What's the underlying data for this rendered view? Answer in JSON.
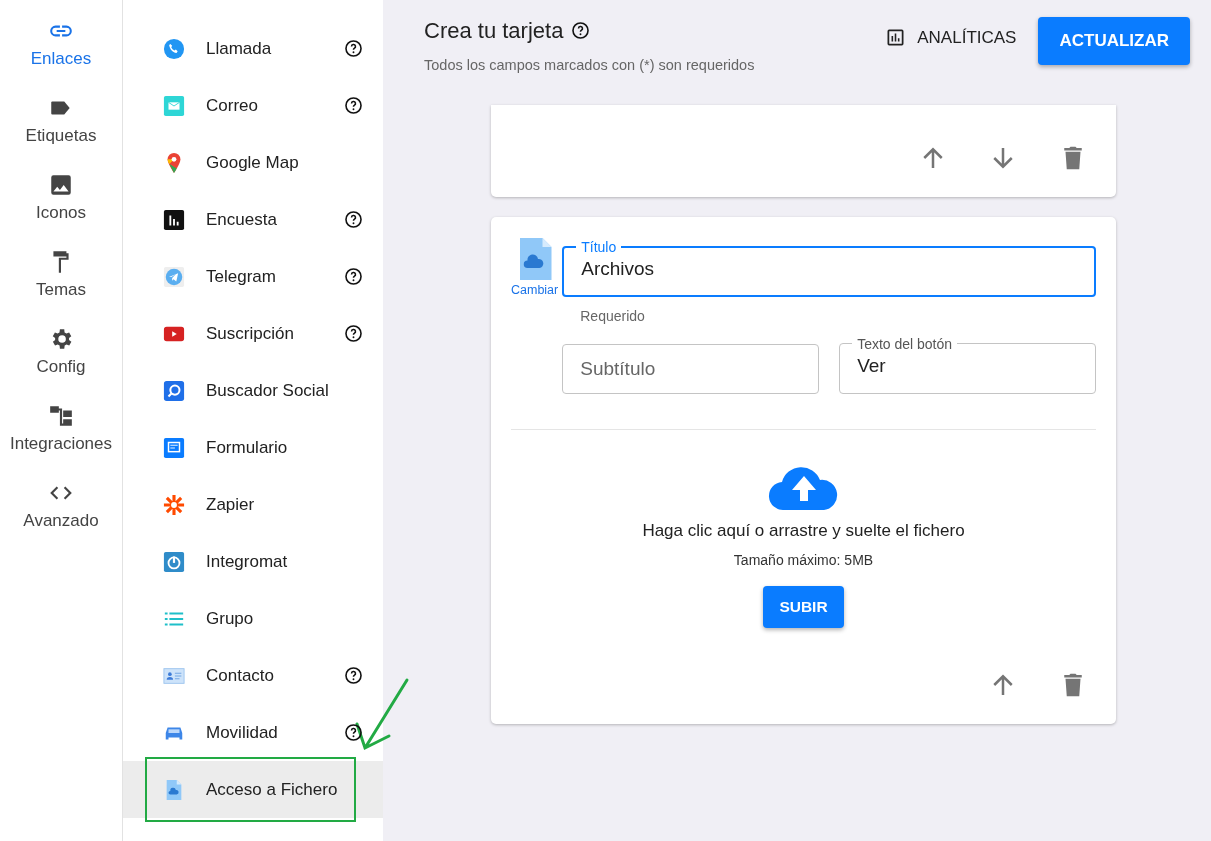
{
  "nav_rail": [
    {
      "label": "Enlaces",
      "selected": true
    },
    {
      "label": "Etiquetas",
      "selected": false
    },
    {
      "label": "Iconos",
      "selected": false
    },
    {
      "label": "Temas",
      "selected": false
    },
    {
      "label": "Config",
      "selected": false
    },
    {
      "label": "Integraciones",
      "selected": false
    },
    {
      "label": "Avanzado",
      "selected": false
    }
  ],
  "link_types": [
    {
      "label": "Llamada",
      "help": true,
      "selected": false,
      "boxed": false,
      "arrow": false
    },
    {
      "label": "Correo",
      "help": true,
      "selected": false,
      "boxed": false,
      "arrow": false
    },
    {
      "label": "Google Map",
      "help": false,
      "selected": false,
      "boxed": false,
      "arrow": false
    },
    {
      "label": "Encuesta",
      "help": true,
      "selected": false,
      "boxed": false,
      "arrow": false
    },
    {
      "label": "Telegram",
      "help": true,
      "selected": false,
      "boxed": false,
      "arrow": false
    },
    {
      "label": "Suscripción",
      "help": true,
      "selected": false,
      "boxed": false,
      "arrow": false
    },
    {
      "label": "Buscador Social",
      "help": false,
      "selected": false,
      "boxed": false,
      "arrow": false
    },
    {
      "label": "Formulario",
      "help": false,
      "selected": false,
      "boxed": false,
      "arrow": false
    },
    {
      "label": "Zapier",
      "help": false,
      "selected": false,
      "boxed": false,
      "arrow": false
    },
    {
      "label": "Integromat",
      "help": false,
      "selected": false,
      "boxed": false,
      "arrow": false
    },
    {
      "label": "Grupo",
      "help": false,
      "selected": false,
      "boxed": false,
      "arrow": false
    },
    {
      "label": "Contacto",
      "help": true,
      "selected": false,
      "boxed": false,
      "arrow": false
    },
    {
      "label": "Movilidad",
      "help": true,
      "selected": false,
      "boxed": false,
      "arrow": true
    },
    {
      "label": "Acceso a Fichero",
      "help": false,
      "selected": true,
      "boxed": true,
      "arrow": false
    }
  ],
  "header": {
    "title": "Crea tu tarjeta",
    "subtitle": "Todos los campos marcados con (*) son requeridos",
    "buttons": [
      {
        "label": "ANALÍTICAS",
        "kind": "text"
      },
      {
        "label": "ACTUALIZAR",
        "kind": "primary"
      }
    ]
  },
  "cards": [
    {
      "kind": "empty",
      "actions": [
        {
          "kind": "up"
        },
        {
          "kind": "down"
        },
        {
          "kind": "delete"
        }
      ]
    },
    {
      "kind": "file",
      "change_label": "Cambiar",
      "title_field": {
        "label": "Título",
        "value": "Archivos",
        "focused": true,
        "helper": "Requerido"
      },
      "subtitle_field": {
        "placeholder": "Subtítulo"
      },
      "button_field": {
        "label": "Texto del botón",
        "value": "Ver"
      },
      "upload": {
        "text": "Haga clic aquí o arrastre y suelte el fichero",
        "limit": "Tamaño máximo: 5MB",
        "button": "SUBIR"
      },
      "actions": [
        {
          "kind": "up"
        },
        {
          "kind": "delete"
        }
      ]
    }
  ]
}
